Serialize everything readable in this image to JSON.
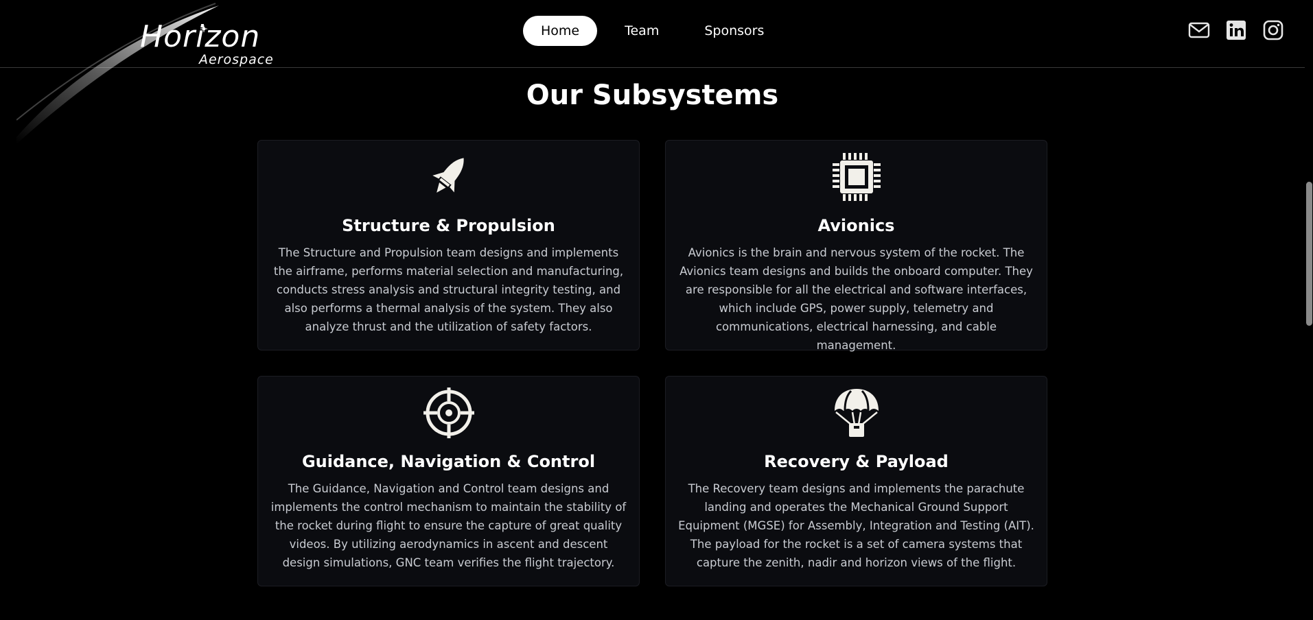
{
  "brand": {
    "name": "Horizon",
    "sub": "Aerospace"
  },
  "nav": {
    "items": [
      {
        "label": "Home",
        "active": true
      },
      {
        "label": "Team",
        "active": false
      },
      {
        "label": "Sponsors",
        "active": false
      }
    ]
  },
  "social": [
    {
      "icon": "mail-icon"
    },
    {
      "icon": "linkedin-icon"
    },
    {
      "icon": "instagram-icon"
    }
  ],
  "section": {
    "title": "Our Subsystems"
  },
  "cards": [
    {
      "icon": "rocket-icon",
      "title": "Structure & Propulsion",
      "desc": "The Structure and Propulsion team designs and implements the airframe, performs material selection and manufacturing, conducts stress analysis and structural integrity testing, and also performs a thermal analysis of the system. They also analyze thrust and the utilization of safety factors."
    },
    {
      "icon": "chip-icon",
      "title": "Avionics",
      "desc": "Avionics is the brain and nervous system of the rocket. The Avionics team designs and builds the onboard computer. They are responsible for all the electrical and software interfaces, which include GPS, power supply, telemetry and communications, electrical harnessing, and cable management."
    },
    {
      "icon": "crosshair-icon",
      "title": "Guidance, Navigation & Control",
      "desc": "The Guidance, Navigation and Control team designs and implements the control mechanism to maintain the stability of the rocket during flight to ensure the capture of great quality videos. By utilizing aerodynamics in ascent and descent design simulations, GNC team verifies the flight trajectory."
    },
    {
      "icon": "parachute-icon",
      "title": "Recovery & Payload",
      "desc": "The Recovery team designs and implements the parachute landing and operates the Mechanical Ground Support Equipment (MGSE) for Assembly, Integration and Testing (AIT). The payload for the rocket is a set of camera systems that capture the zenith, nadir and horizon views of the flight."
    }
  ],
  "colors": {
    "background": "#000000",
    "card": "#0b0c10",
    "text": "#ffffff",
    "muted": "#c9ccd2"
  }
}
